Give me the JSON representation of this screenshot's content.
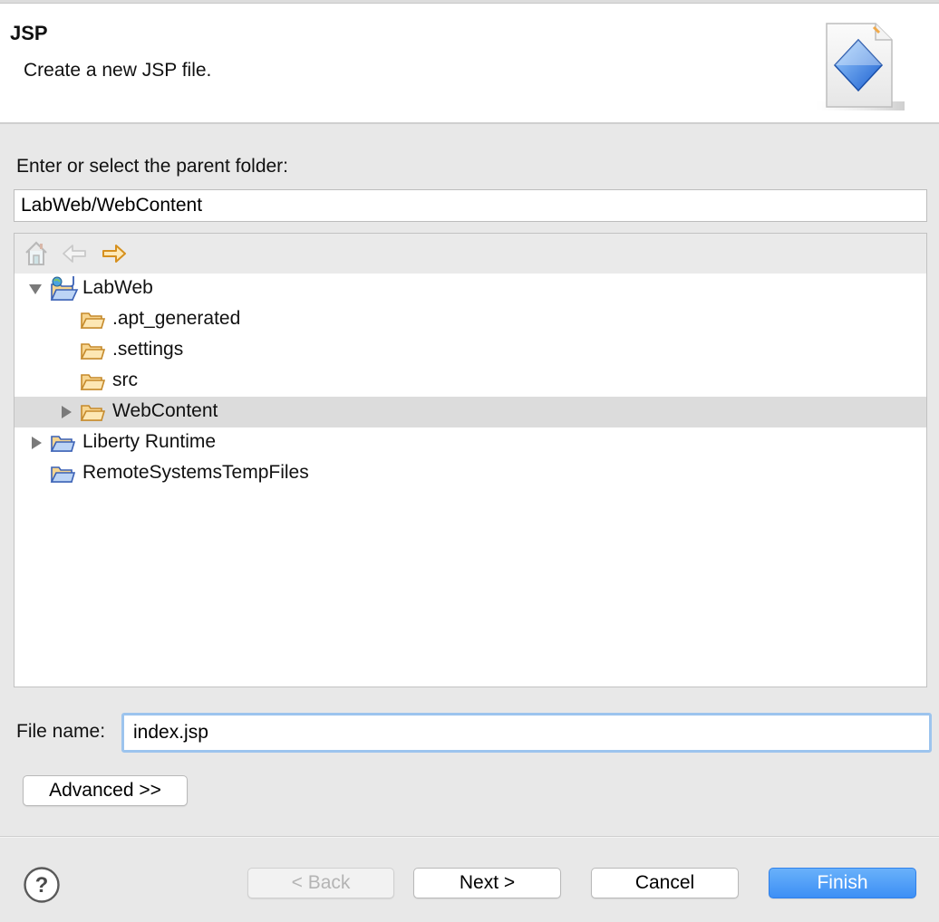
{
  "header": {
    "title": "JSP",
    "description": "Create a new JSP file.",
    "image_icon": "jsp-wizard-banner-icon"
  },
  "folder": {
    "label": "Enter or select the parent folder:",
    "value": "LabWeb/WebContent"
  },
  "tree_toolbar": {
    "home_icon": "home-icon",
    "back_icon": "back-arrow-icon",
    "forward_icon": "forward-arrow-icon"
  },
  "tree": {
    "items": [
      {
        "label": "LabWeb",
        "level": 0,
        "expanded": true,
        "has_children": true,
        "icon": "web-project-folder-icon",
        "selected": false
      },
      {
        "label": ".apt_generated",
        "level": 1,
        "has_children": false,
        "icon": "folder-icon",
        "selected": false
      },
      {
        "label": ".settings",
        "level": 1,
        "has_children": false,
        "icon": "folder-icon",
        "selected": false
      },
      {
        "label": "src",
        "level": 1,
        "has_children": false,
        "icon": "folder-icon",
        "selected": false
      },
      {
        "label": "WebContent",
        "level": 1,
        "expanded": false,
        "has_children": true,
        "icon": "folder-icon",
        "selected": true
      },
      {
        "label": "Liberty Runtime",
        "level": 0,
        "expanded": false,
        "has_children": true,
        "icon": "project-folder-icon",
        "selected": false
      },
      {
        "label": "RemoteSystemsTempFiles",
        "level": 0,
        "has_children": false,
        "icon": "project-folder-icon",
        "selected": false
      }
    ]
  },
  "file": {
    "label": "File name:",
    "value": "index.jsp"
  },
  "advanced_label": "Advanced >>",
  "footer": {
    "help_icon": "help-icon",
    "back_label": "< Back",
    "next_label": "Next >",
    "cancel_label": "Cancel",
    "finish_label": "Finish"
  },
  "colors": {
    "primary_button": "#3d8ff5",
    "focus_ring": "#9cc4ee",
    "folder_fill": "#f7d590",
    "folder_stroke": "#c58a2b"
  }
}
